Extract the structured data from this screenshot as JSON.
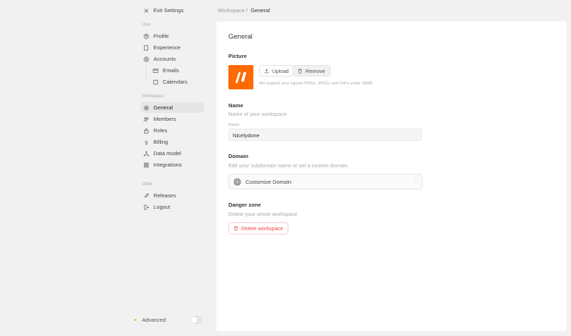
{
  "sidebar": {
    "exit": "Exit Settings",
    "user_label": "User",
    "user_items": [
      "Profile",
      "Experience",
      "Accounts"
    ],
    "account_sub": [
      "Emails",
      "Calendars"
    ],
    "workspace_label": "Workspace",
    "workspace_items": [
      "General",
      "Members",
      "Roles",
      "Billing",
      "Data model",
      "Integrations"
    ],
    "other_label": "Other",
    "other_items": [
      "Releases",
      "Logout"
    ],
    "advanced": "Advanced:",
    "advanced_on": false
  },
  "breadcrumb": {
    "parent": "Workspace /",
    "current": "General"
  },
  "main": {
    "title": "General",
    "picture": {
      "label": "Picture",
      "upload": "Upload",
      "remove": "Remove",
      "hint": "We support your square PNGs, JPEGs and GIFs under 10MB"
    },
    "name": {
      "title": "Name",
      "desc": "Name of your workspace",
      "field_label": "Name",
      "value": "Nicelydone"
    },
    "domain": {
      "title": "Domain",
      "desc": "Edit your subdomain name or set a custom domain.",
      "button": "Customize Domain"
    },
    "danger": {
      "title": "Danger zone",
      "desc": "Delete your whole workspace",
      "button": "Delete workspace"
    }
  },
  "colors": {
    "accent": "#ff6a00",
    "danger": "#f04444"
  }
}
